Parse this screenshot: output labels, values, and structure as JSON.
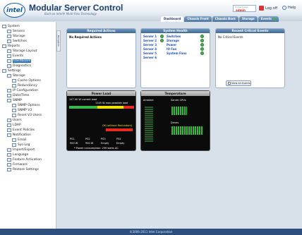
{
  "header": {
    "logo_text": "intel",
    "title": "Modular Server Control",
    "subtitle": "Built on Intel® Multi-Flex Technology",
    "user_caption": "Current user",
    "user_name": "admin",
    "logoff_label": "Log off",
    "help_label": "Help"
  },
  "tabs": [
    {
      "label": "Dashboard"
    },
    {
      "label": "Chassis Front"
    },
    {
      "label": "Chassis Back"
    },
    {
      "label": "Storage"
    },
    {
      "label": "Events"
    }
  ],
  "nav_tab_label": "Navigation",
  "sidebar": [
    {
      "label": "System"
    },
    {
      "label": "Servers"
    },
    {
      "label": "Storage"
    },
    {
      "label": "Switches"
    },
    {
      "label": "Reports"
    },
    {
      "label": "Storage Layout"
    },
    {
      "label": "Events"
    },
    {
      "label": "Dashboard"
    },
    {
      "label": "Diagnostics"
    },
    {
      "label": "Settings"
    },
    {
      "label": "Storage"
    },
    {
      "label": "Cache Options"
    },
    {
      "label": "Redundancy"
    },
    {
      "label": "IP Configuration"
    },
    {
      "label": "Date/Time"
    },
    {
      "label": "SNMP"
    },
    {
      "label": "SNMP Options"
    },
    {
      "label": "SNMP V3"
    },
    {
      "label": "Reset V3 Users"
    },
    {
      "label": "Users"
    },
    {
      "label": "LDAP"
    },
    {
      "label": "Event Policies"
    },
    {
      "label": "Notification"
    },
    {
      "label": "Email"
    },
    {
      "label": "Sys-Log"
    },
    {
      "label": "Import/Export"
    },
    {
      "label": "Language"
    },
    {
      "label": "Feature Activation"
    },
    {
      "label": "Firmware"
    },
    {
      "label": "Restore Settings"
    }
  ],
  "required_actions": {
    "title": "Required Actions",
    "text": "No Required Actions"
  },
  "system_health": {
    "title": "System Health",
    "servers": [
      "Server 1",
      "Server 2",
      "Server 3",
      "Server 4",
      "Server 5",
      "Server 6"
    ],
    "components": [
      "Switches",
      "Storage",
      "Power",
      "IO Fan",
      "System Fans"
    ]
  },
  "recent_events": {
    "title": "Recent Critical Events",
    "text": "No Critical Events",
    "button_label": "View All Events"
  },
  "power_load": {
    "title": "Power Load",
    "current_load": "147.00 W current load",
    "max_possible": "1145 W max possible load",
    "ok_redundant": "OK (without Redundant)",
    "psus": [
      "PS1",
      "PS2",
      "PS3",
      "PS4"
    ],
    "psu_status": [
      "900 W",
      "900 W",
      "Empty",
      "Empty"
    ],
    "consumption": "* Power consumption: 299 watts AC",
    "ok_color": "#3bb54a",
    "warn_color": "#f3e000",
    "alert_color": "#ea2a1f"
  },
  "temperature": {
    "title": "Temperature",
    "ambient": "Ambient",
    "server_cpus": "Server CPUs",
    "drives": "Drives"
  },
  "footer": "©2006-2011 Intel Corporation"
}
